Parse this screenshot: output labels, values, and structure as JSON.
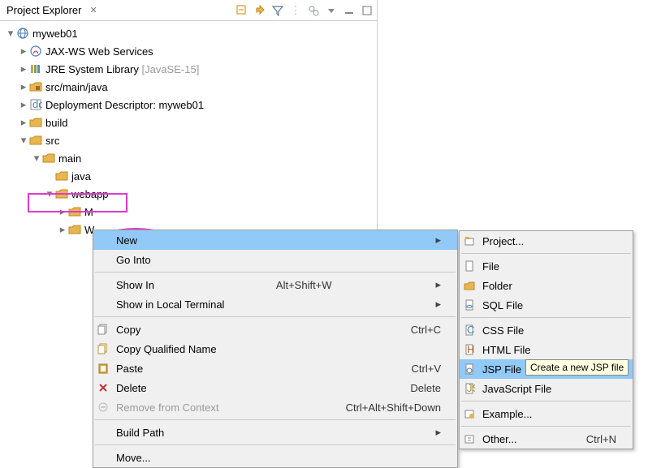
{
  "panel": {
    "title": "Project Explorer"
  },
  "project": {
    "name": "myweb01"
  },
  "tree": {
    "jaxws": "JAX-WS Web Services",
    "jre": "JRE System Library",
    "jre_suffix": " [JavaSE-15]",
    "srcmainjava": "src/main/java",
    "deploy": "Deployment Descriptor: myweb01",
    "build": "build",
    "src": "src",
    "main": "main",
    "java": "java",
    "webapp": "webapp",
    "m_partial": "M",
    "w_partial": "W"
  },
  "ctx": {
    "new": "New",
    "go_into": "Go Into",
    "show_in": "Show In",
    "show_in_sc": "Alt+Shift+W",
    "show_terminal": "Show in Local Terminal",
    "copy": "Copy",
    "copy_sc": "Ctrl+C",
    "copy_qn": "Copy Qualified Name",
    "paste": "Paste",
    "paste_sc": "Ctrl+V",
    "delete": "Delete",
    "delete_sc": "Delete",
    "remove_ctx": "Remove from Context",
    "remove_ctx_sc": "Ctrl+Alt+Shift+Down",
    "build_path": "Build Path",
    "move": "Move..."
  },
  "sub": {
    "project": "Project...",
    "file": "File",
    "folder": "Folder",
    "sql": "SQL File",
    "css": "CSS File",
    "html": "HTML File",
    "jsp": "JSP File",
    "js": "JavaScript File",
    "example": "Example...",
    "other": "Other...",
    "other_sc": "Ctrl+N"
  },
  "tooltip": "Create a new JSP file"
}
